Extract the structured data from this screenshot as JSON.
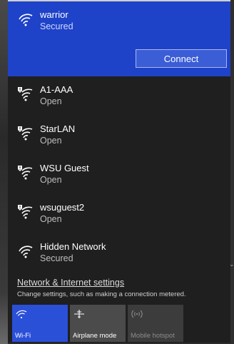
{
  "networks": [
    {
      "ssid": "warrior",
      "status": "Secured"
    },
    {
      "ssid": "A1-AAA",
      "status": "Open"
    },
    {
      "ssid": "StarLAN",
      "status": "Open"
    },
    {
      "ssid": "WSU Guest",
      "status": "Open"
    },
    {
      "ssid": "wsuguest2",
      "status": "Open"
    },
    {
      "ssid": "Hidden Network",
      "status": "Secured"
    }
  ],
  "connect_button": "Connect",
  "settings": {
    "link": "Network & Internet settings",
    "description": "Change settings, such as making a connection metered."
  },
  "quick_actions": [
    {
      "label": "Wi-Fi",
      "icon": "wifi-icon"
    },
    {
      "label": "Airplane mode",
      "icon": "airplane-icon"
    },
    {
      "label": "Mobile hotspot",
      "icon": "hotspot-icon"
    }
  ],
  "colors": {
    "accent": "#1e42c8",
    "background": "#1f1f1f"
  }
}
